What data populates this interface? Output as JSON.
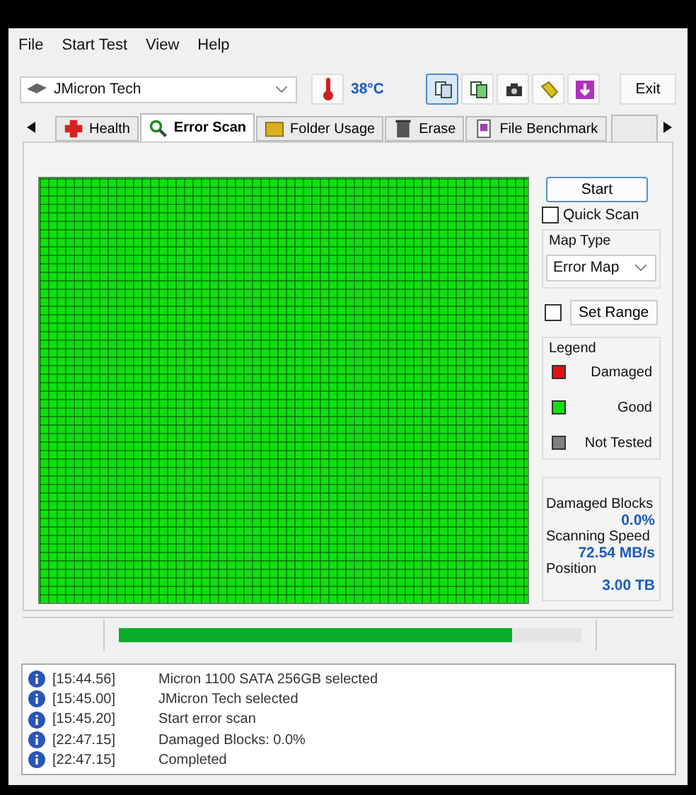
{
  "menu": [
    "File",
    "Start Test",
    "View",
    "Help"
  ],
  "drive": {
    "value": "JMicron Tech"
  },
  "temperature": "38°C",
  "toolbar_buttons": [
    {
      "selected": true
    },
    {
      "selected": false
    },
    {
      "selected": false
    },
    {
      "selected": false
    },
    {
      "selected": false
    }
  ],
  "exit_button": "Exit",
  "tabs": [
    {
      "label": "Health",
      "selected": false
    },
    {
      "label": "Error Scan",
      "selected": true
    },
    {
      "label": "Folder Usage",
      "selected": false
    },
    {
      "label": "Erase",
      "selected": false
    },
    {
      "label": "File Benchmark",
      "selected": false
    }
  ],
  "start_button": "Start",
  "quick_scan": {
    "label": "Quick Scan",
    "checked": false
  },
  "map_type": {
    "title": "Map Type",
    "value": "Error Map"
  },
  "set_range": {
    "label": "Set Range",
    "checked": false
  },
  "legend": {
    "title": "Legend",
    "items": [
      {
        "label": "Damaged",
        "color": "#e01010"
      },
      {
        "label": "Good",
        "color": "#10e010"
      },
      {
        "label": "Not Tested",
        "color": "#808080"
      }
    ]
  },
  "stats": [
    {
      "label": "Damaged Blocks",
      "value": "0.0%"
    },
    {
      "label": "Scanning Speed",
      "value": "72.54 MB/s"
    },
    {
      "label": "Position",
      "value": "3.00 TB"
    }
  ],
  "progress": {
    "level": 0.85
  },
  "log": [
    {
      "time": "[15:44.56]",
      "message": "Micron 1100 SATA 256GB selected"
    },
    {
      "time": "[15:45.00]",
      "message": "JMicron Tech selected"
    },
    {
      "time": "[15:45.20]",
      "message": "Start error scan"
    },
    {
      "time": "[22:47.15]",
      "message": "Damaged Blocks: 0.0%"
    },
    {
      "time": "[22:47.15]",
      "message": "Completed"
    }
  ]
}
